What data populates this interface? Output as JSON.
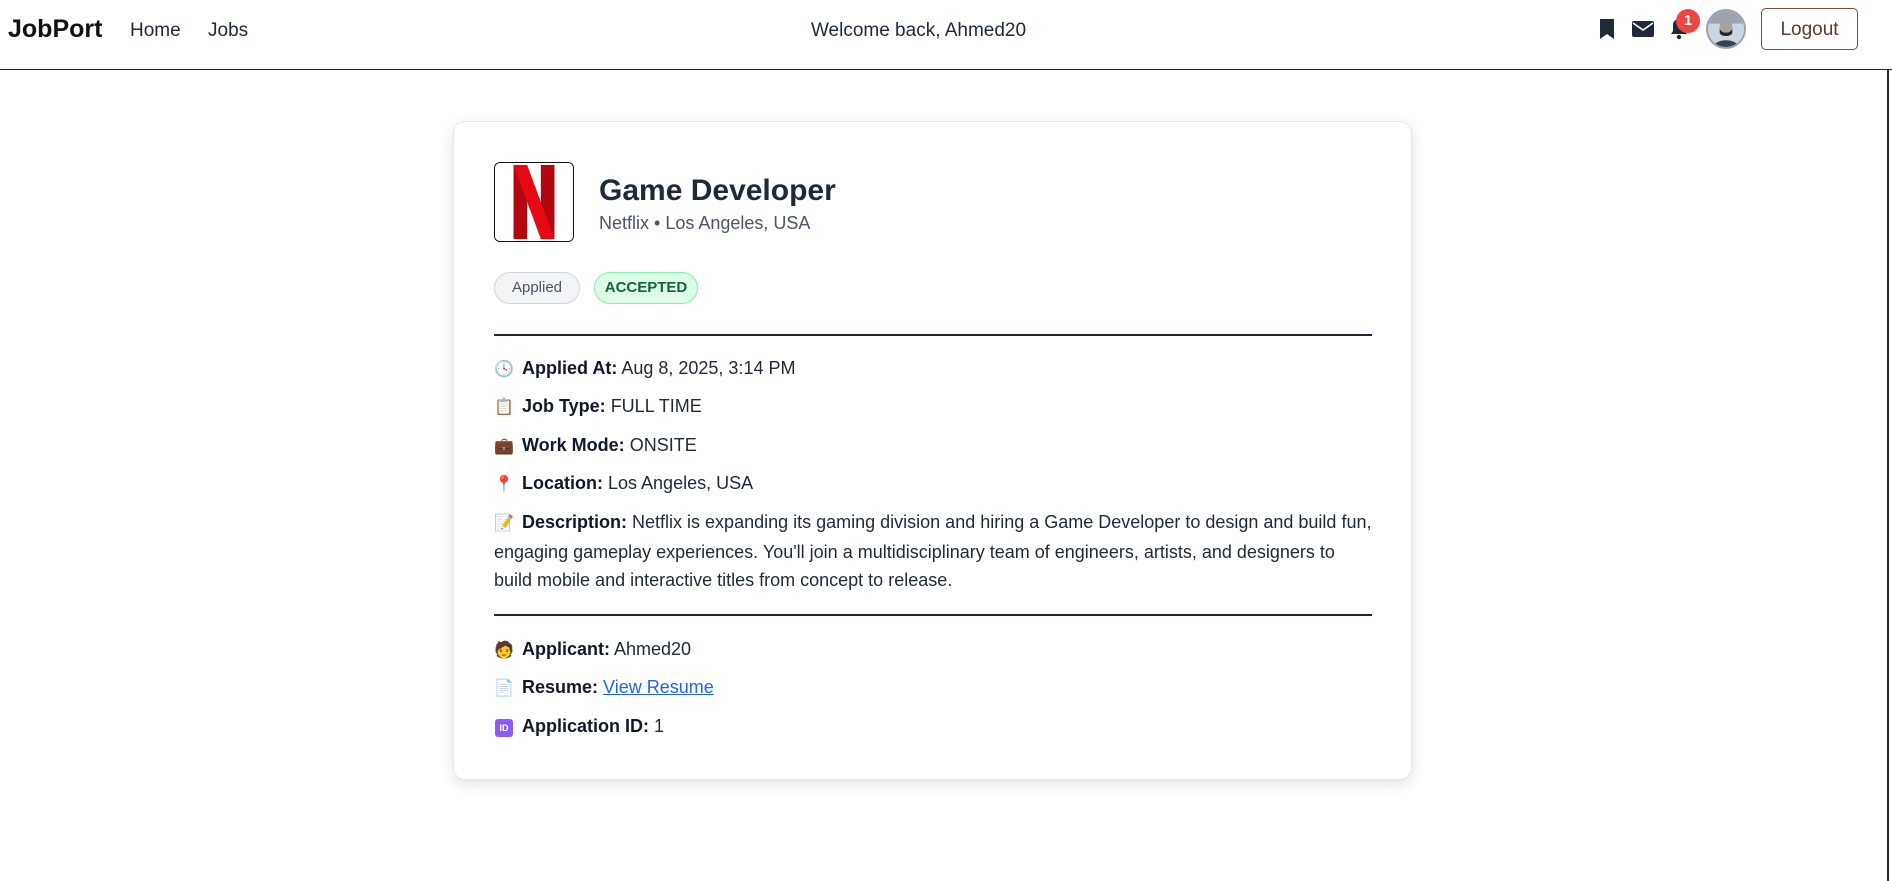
{
  "navbar": {
    "brand": "JobPort",
    "links": {
      "home": "Home",
      "jobs": "Jobs"
    },
    "welcome": "Welcome back, Ahmed20",
    "notification_count": "1",
    "logout_label": "Logout",
    "icons": [
      "bookmark-icon",
      "mail-icon",
      "bell-icon",
      "avatar"
    ]
  },
  "job": {
    "title": "Game Developer",
    "subtitle": "Netflix • Los Angeles, USA",
    "company_logo": "netflix-logo",
    "status_badges": {
      "applied": "Applied",
      "status": "ACCEPTED"
    },
    "details": {
      "applied_at": {
        "label": "Applied At:",
        "value": "Aug 8, 2025, 3:14 PM"
      },
      "job_type": {
        "label": "Job Type:",
        "value": "FULL TIME"
      },
      "work_mode": {
        "label": "Work Mode:",
        "value": "ONSITE"
      },
      "location": {
        "label": "Location:",
        "value": "Los Angeles, USA"
      },
      "description": {
        "label": "Description:",
        "value": "Netflix is expanding its gaming division and hiring a Game Developer to design and build fun, engaging gameplay experiences. You'll join a multidisciplinary team of engineers, artists, and designers to build mobile and interactive titles from concept to release."
      }
    },
    "application": {
      "applicant": {
        "label": "Applicant:",
        "value": "Ahmed20"
      },
      "resume": {
        "label": "Resume:",
        "link_text": "View Resume"
      },
      "application_id": {
        "label": "Application ID:",
        "value": "1",
        "icon_text": "ID"
      }
    }
  },
  "colors": {
    "accepted_bg": "#dcfce7",
    "accepted_text": "#166534",
    "notification": "#ef4444",
    "link": "#2563eb",
    "logout_border": "#7a4a3a"
  }
}
